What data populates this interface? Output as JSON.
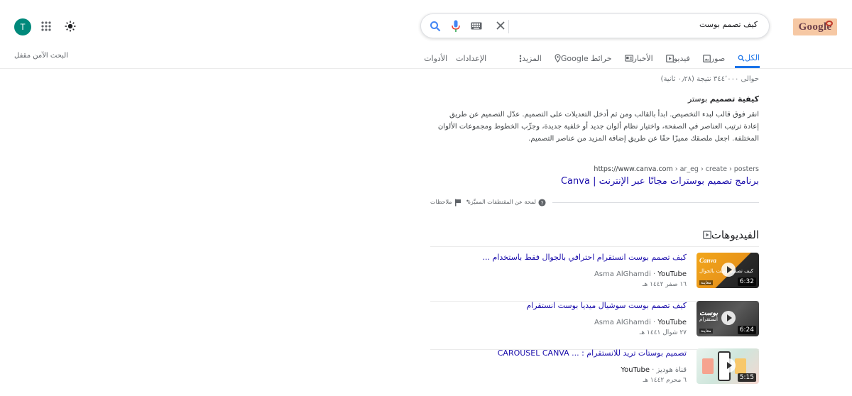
{
  "header": {
    "logo_text": "Google",
    "search_query": "كيف تصمم بوست",
    "avatar_letter": "T"
  },
  "tabs": [
    {
      "label": "الكل",
      "icon": "search-icon",
      "active": true
    },
    {
      "label": "صور",
      "icon": "image-icon"
    },
    {
      "label": "فيديو",
      "icon": "video-icon"
    },
    {
      "label": "الأخبار",
      "icon": "news-icon"
    },
    {
      "label": "خرائط Google",
      "icon": "map-pin-icon"
    },
    {
      "label": "المزيد",
      "icon": "more-vert-icon"
    },
    {
      "label": "الإعدادات"
    },
    {
      "label": "الأدوات"
    }
  ],
  "safe_search": "البحث الآمن مقفل",
  "results": {
    "stats": "حوالى ٣٤٤٬٠٠٠ نتيجة (٠٫٢٨ ثانية)",
    "snippet_title_bold": "كيفية تصميم",
    "snippet_title_rest": " بوستر",
    "snippet_text": "انقر فوق قالب لبدء التخصيص. ابدأ بالقالب ومن ثم أدخل التعديلات على التصميم. عدّل التصميم عن طريق إعادة ترتيب العناصر في الصفحة، واختيار نظام ألوان جديد أو خلفية جديدة، وجرِّب الخطوط ومجموعات الألوان المختلفة. اجعل ملصقك مميزًا حقًا عن طريق إضافة المزيد من عناصر التصميم.",
    "url_domain": "https://www.canva.com",
    "url_path": " › ar_eg › create › posters",
    "title": "برنامج تصميم بوسترات مجانًا عبر الإنترنت | Canva",
    "featured_about": "لمحة عن المقتطفات المميَّزة",
    "feedback": "ملاحظات"
  },
  "videos": {
    "heading": "الفيديوهات",
    "items": [
      {
        "title": "كيف تصمم بوست انستقرام احترافي بالجوال فقط باستخدام ...",
        "channel": "Asma AlGhamdi",
        "source": "YouTube",
        "date": "١٦ صفر ١٤٤٢ هـ",
        "duration": "6:32",
        "thumb_title": "Canva",
        "thumb_sub": "كيف تصمم بوست بالجوال",
        "thumb_badge": "معاينة"
      },
      {
        "title": "كيف تصمم بوست سوشيال ميديا بوست انستقرام",
        "channel": "Asma AlGhamdi",
        "source": "YouTube",
        "date": "٢٧ شوال ١٤٤١ هـ",
        "duration": "6:24",
        "thumb_title": "بوست",
        "thumb_sub": "انستقرام",
        "thumb_badge": "معاينة"
      },
      {
        "title": "تصميم بوستات تريد للانستقرام : ... CAROUSEL CANVA",
        "channel": "قناة هوديز",
        "source": "YouTube",
        "date": "٦ محرم ١٤٤٢ هـ",
        "duration": "5:15",
        "thumb_title": "",
        "thumb_sub": "",
        "thumb_badge": ""
      }
    ]
  },
  "colors": {
    "link": "#1a0dab",
    "accent": "#1a73e8",
    "avatar": "#00897b"
  }
}
